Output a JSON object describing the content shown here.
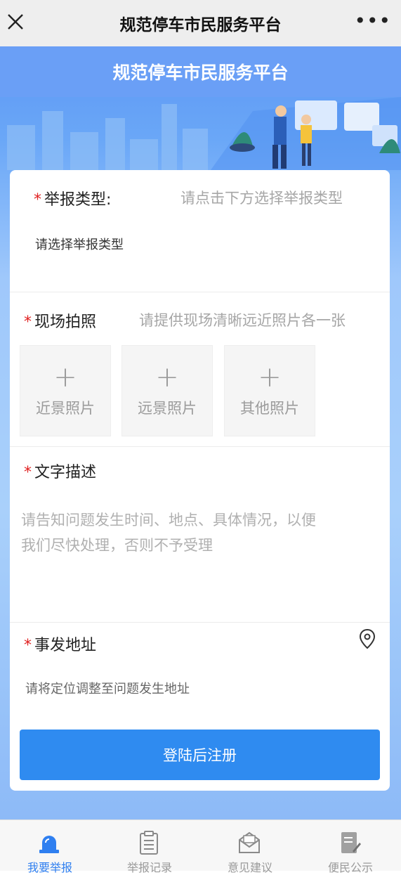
{
  "window": {
    "title": "规范停车市民服务平台",
    "close_icon": "close-icon",
    "more_label": "•••"
  },
  "banner": {
    "title": "规范停车市民服务平台"
  },
  "form": {
    "report_type": {
      "label": "举报类型:",
      "hint": "请点击下方选择举报类型",
      "value": "请选择举报类型"
    },
    "photos": {
      "label": "现场拍照",
      "hint": "请提供现场清晰远近照片各一张",
      "slots": [
        {
          "plus": "+",
          "label": "近景照片"
        },
        {
          "plus": "+",
          "label": "远景照片"
        },
        {
          "plus": "+",
          "label": "其他照片"
        }
      ]
    },
    "description": {
      "label": "文字描述",
      "placeholder_line1": "请告知问题发生时间、地点、具体情况，以便",
      "placeholder_line2": "我们尽快处理，否则不予受理"
    },
    "address": {
      "label": "事发地址",
      "value": "请将定位调整至问题发生地址",
      "location_icon": "location-pin-icon"
    },
    "required_mark": "*",
    "submit_label": "登陆后注册"
  },
  "tabbar": {
    "items": [
      {
        "label": "我要举报",
        "icon": "alarm-light-icon",
        "active": true
      },
      {
        "label": "举报记录",
        "icon": "clipboard-icon",
        "active": false
      },
      {
        "label": "意见建议",
        "icon": "envelope-icon",
        "active": false
      },
      {
        "label": "便民公示",
        "icon": "notice-edit-icon",
        "active": false
      }
    ]
  },
  "colors": {
    "brand_blue": "#2f8bf0",
    "banner_blue": "#6a9ff6",
    "required_red": "#e02020"
  }
}
